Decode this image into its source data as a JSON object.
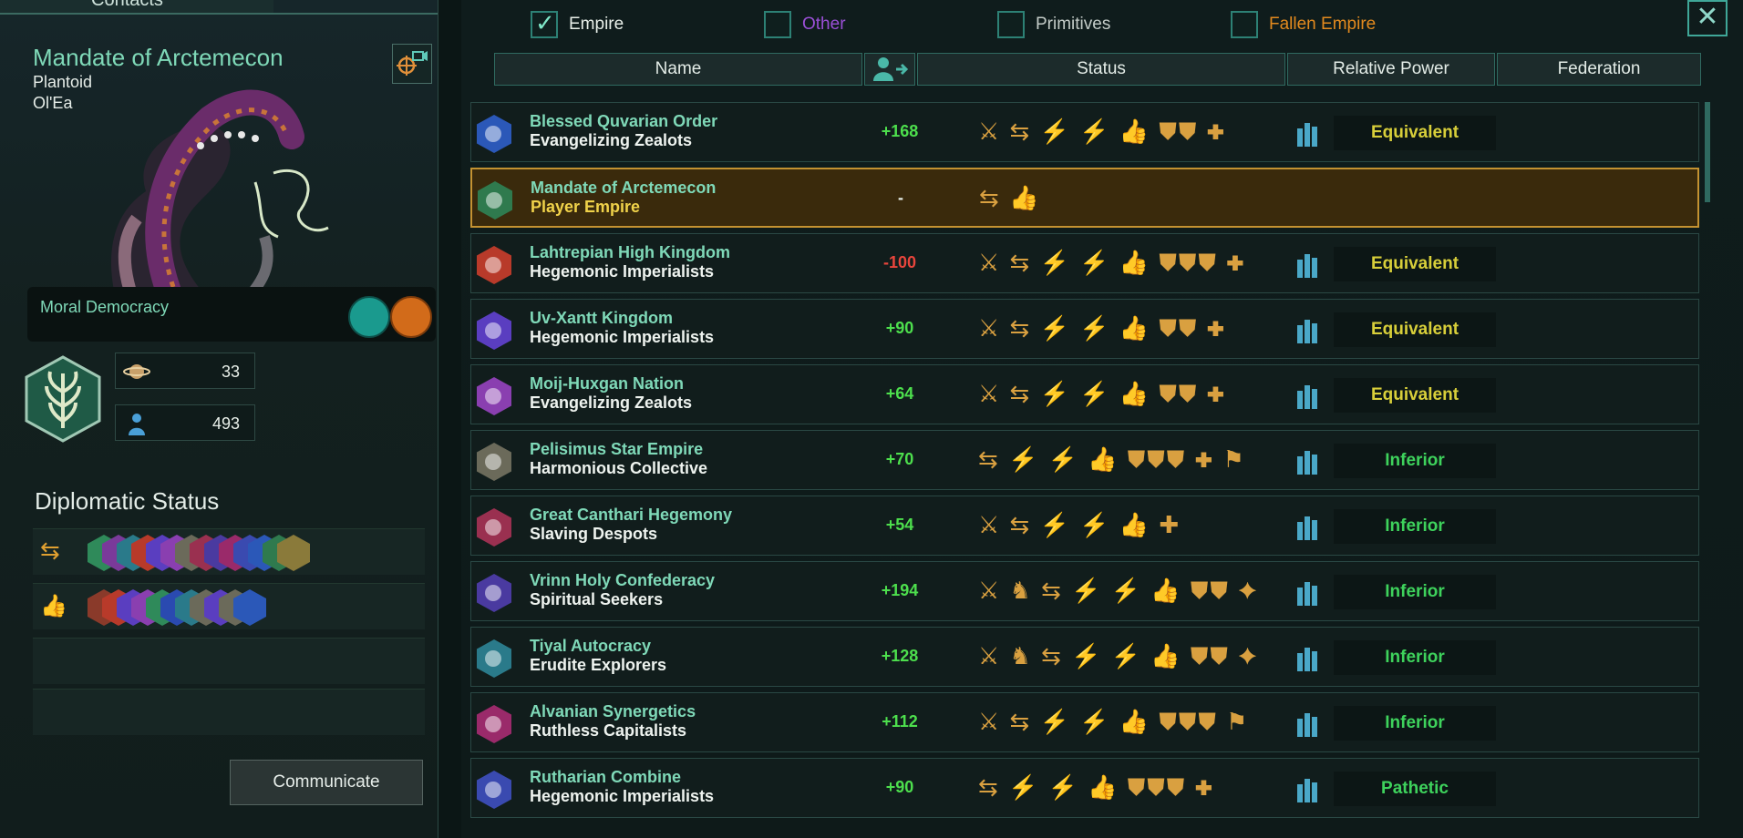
{
  "window": {
    "tab_title": "Contacts"
  },
  "left": {
    "empire_name": "Mandate of Arctemecon",
    "species": "Plantoid",
    "origin": "Ol'Ea",
    "government": "Moral Democracy",
    "planets": "33",
    "pops": "493",
    "diplomatic_status_title": "Diplomatic Status",
    "communicate_label": "Communicate"
  },
  "filters": [
    {
      "label": "Empire",
      "checked": true,
      "color": "#e8efe9"
    },
    {
      "label": "Other",
      "checked": false,
      "color": "#9a4fd6"
    },
    {
      "label": "Primitives",
      "checked": false,
      "color": "#c3cbc7"
    },
    {
      "label": "Fallen Empire",
      "checked": false,
      "color": "#e38a1e"
    }
  ],
  "columns": {
    "name": "Name",
    "status": "Status",
    "relative_power": "Relative Power",
    "federation": "Federation"
  },
  "rows": [
    {
      "name": "Blessed Quvarian Order",
      "ethic": "Evangelizing Zealots",
      "opinion": "+168",
      "opinion_kind": "pos",
      "status_icons": "⚔ ⇆ ⚡ ⚡ 👍 ⛊⛊ ✚",
      "relative_power": "Equivalent",
      "rp_kind": "eq",
      "emblem_color": "#2b58b8"
    },
    {
      "name": "Mandate of Arctemecon",
      "ethic": "Player Empire",
      "opinion": "-",
      "opinion_kind": "neu",
      "status_icons": "⇆ 👍",
      "relative_power": "",
      "rp_kind": "",
      "emblem_color": "#2f7a4e",
      "player": true
    },
    {
      "name": "Lahtrepian High Kingdom",
      "ethic": "Hegemonic Imperialists",
      "opinion": "-100",
      "opinion_kind": "neg",
      "status_icons": "⚔ ⇆ ⚡ ⚡ 👍 ⛊⛊⛊ ✚",
      "relative_power": "Equivalent",
      "rp_kind": "eq",
      "emblem_color": "#b83a2a"
    },
    {
      "name": "Uv-Xantt Kingdom",
      "ethic": "Hegemonic Imperialists",
      "opinion": "+90",
      "opinion_kind": "pos",
      "status_icons": "⚔ ⇆ ⚡ ⚡ 👍 ⛊⛊ ✚",
      "relative_power": "Equivalent",
      "rp_kind": "eq",
      "emblem_color": "#5a3ec0"
    },
    {
      "name": "Moij-Huxgan Nation",
      "ethic": "Evangelizing Zealots",
      "opinion": "+64",
      "opinion_kind": "pos",
      "status_icons": "⚔ ⇆ ⚡ ⚡ 👍 ⛊⛊ ✚",
      "relative_power": "Equivalent",
      "rp_kind": "eq",
      "emblem_color": "#8a3fb0"
    },
    {
      "name": "Pelisimus Star Empire",
      "ethic": "Harmonious Collective",
      "opinion": "+70",
      "opinion_kind": "pos",
      "status_icons": "⇆ ⚡ ⚡ 👍 ⛊⛊⛊ ✚ ⚑",
      "relative_power": "Inferior",
      "rp_kind": "inf",
      "emblem_color": "#6b6a5a"
    },
    {
      "name": "Great Canthari Hegemony",
      "ethic": "Slaving Despots",
      "opinion": "+54",
      "opinion_kind": "pos",
      "status_icons": "⚔ ⇆ ⚡ ⚡ 👍 ✚",
      "relative_power": "Inferior",
      "rp_kind": "inf",
      "emblem_color": "#9a3050"
    },
    {
      "name": "Vrinn Holy Confederacy",
      "ethic": "Spiritual Seekers",
      "opinion": "+194",
      "opinion_kind": "pos",
      "status_icons": "⚔ ♞ ⇆ ⚡ ⚡ 👍 ⛊⛊ ✦",
      "relative_power": "Inferior",
      "rp_kind": "inf",
      "emblem_color": "#4a3aa0"
    },
    {
      "name": "Tiyal Autocracy",
      "ethic": "Erudite Explorers",
      "opinion": "+128",
      "opinion_kind": "pos",
      "status_icons": "⚔ ♞ ⇆ ⚡ ⚡ 👍 ⛊⛊ ✦",
      "relative_power": "Inferior",
      "rp_kind": "inf",
      "emblem_color": "#2a7a8a"
    },
    {
      "name": "Alvanian Synergetics",
      "ethic": "Ruthless Capitalists",
      "opinion": "+112",
      "opinion_kind": "pos",
      "status_icons": "⚔ ⇆ ⚡ ⚡ 👍 ⛊⛊⛊ ⚑",
      "relative_power": "Inferior",
      "rp_kind": "inf",
      "emblem_color": "#9a2a6a"
    },
    {
      "name": "Rutharian Combine",
      "ethic": "Hegemonic Imperialists",
      "opinion": "+90",
      "opinion_kind": "pos",
      "status_icons": "⇆ ⚡ ⚡ 👍 ⛊⛊⛊ ✚",
      "relative_power": "Pathetic",
      "rp_kind": "pat",
      "emblem_color": "#3a4ab0"
    }
  ],
  "diplomatic_relations": {
    "row1_icons": [
      "#2f8a5a",
      "#7a3a9a",
      "#2a7a8a",
      "#b83a2a",
      "#5a3ec0",
      "#8a3fb0",
      "#6b6a5a",
      "#9a3050",
      "#4a3aa0",
      "#9a2a6a",
      "#3a4ab0",
      "#2b58b8",
      "#2f7a4e",
      "#8a7a3a"
    ],
    "row2_icons": [
      "#8a3a2a",
      "#b83a2a",
      "#5a3ec0",
      "#8a3fb0",
      "#2f8a5a",
      "#2a4ab0",
      "#2a7a8a",
      "#6b6a5a",
      "#5a3ec0",
      "#6b6a5a",
      "#2b58b8"
    ]
  }
}
